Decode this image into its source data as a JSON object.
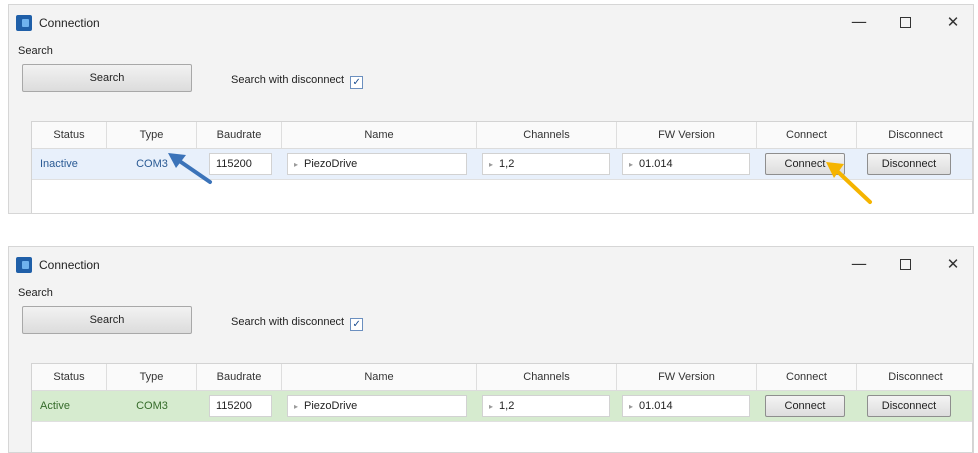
{
  "windows": [
    {
      "title": "Connection",
      "search_group_label": "Search",
      "search_button": "Search",
      "search_with_disconnect_label": "Search with disconnect",
      "search_with_disconnect_checked": true,
      "columns": [
        "Status",
        "Type",
        "Baudrate",
        "Name",
        "Channels",
        "FW Version",
        "Connect",
        "Disconnect"
      ],
      "row": {
        "status": "Inactive",
        "type": "COM3",
        "baudrate": "115200",
        "name": "PiezoDrive",
        "channels": "1,2",
        "fw_version": "01.014",
        "connect_label": "Connect",
        "disconnect_label": "Disconnect",
        "row_color": "#e8f0fb"
      }
    },
    {
      "title": "Connection",
      "search_group_label": "Search",
      "search_button": "Search",
      "search_with_disconnect_label": "Search with disconnect",
      "search_with_disconnect_checked": true,
      "columns": [
        "Status",
        "Type",
        "Baudrate",
        "Name",
        "Channels",
        "FW Version",
        "Connect",
        "Disconnect"
      ],
      "row": {
        "status": "Active",
        "type": "COM3",
        "baudrate": "115200",
        "name": "PiezoDrive",
        "channels": "1,2",
        "fw_version": "01.014",
        "connect_label": "Connect",
        "disconnect_label": "Disconnect",
        "row_color": "#d6ebcf"
      }
    }
  ],
  "window_controls": {
    "minimize_icon": "minimize-icon",
    "maximize_icon": "maximize-icon",
    "close_icon": "close-icon"
  },
  "annotations": [
    {
      "icon": "arrow-pointing-to-type-cell",
      "color": "#3b73b9"
    },
    {
      "icon": "arrow-pointing-to-connect-button",
      "color": "#f5b400"
    }
  ]
}
